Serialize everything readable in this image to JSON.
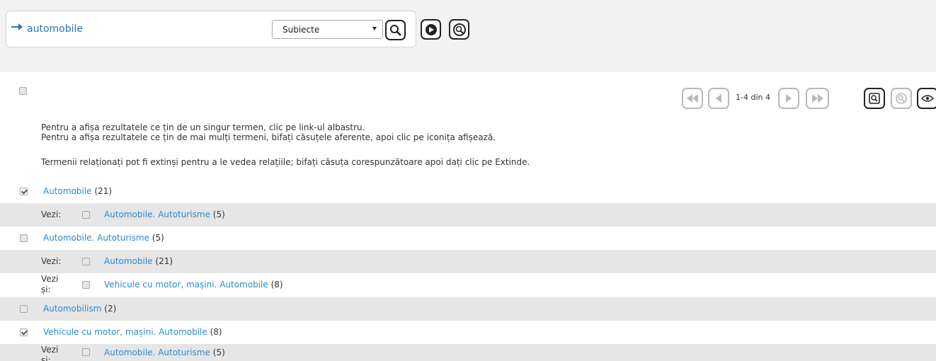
{
  "search": {
    "query": "automobile",
    "scope_selected": "Subiecte"
  },
  "pager": {
    "info": "1-4 din 4"
  },
  "instructions": {
    "line1": "Pentru a afișa rezultatele ce țin de un singur termen, clic pe link-ul albastru.",
    "line2": "Pentru a afișa rezultatele ce țin de mai mulți termeni, bifați căsuțele aferente, apoi clic pe iconița afișează.",
    "line3": "Termenii relaționați pot fi extinși pentru a le vedea relațiile; bifați căsuța corespunzătoare apoi dați clic pe Extinde."
  },
  "rows": [
    {
      "kind": "term",
      "label": "Automobile",
      "count": "(21)",
      "checked": true
    },
    {
      "kind": "related",
      "rel": "Vezi:",
      "label": "Automobile. Autoturisme",
      "count": "(5)"
    },
    {
      "kind": "term",
      "label": "Automobile. Autoturisme",
      "count": "(5)",
      "checked": false
    },
    {
      "kind": "related",
      "rel": "Vezi:",
      "label": "Automobile",
      "count": "(21)"
    },
    {
      "kind": "related",
      "rel_line1": "Vezi",
      "rel_line2": "și:",
      "label": "Vehicule cu motor, mașini. Automobile",
      "count": "(8)"
    },
    {
      "kind": "term",
      "label": "Automobilism",
      "count": "(2)",
      "checked": false
    },
    {
      "kind": "term",
      "label": "Vehicule cu motor, mașini. Automobile",
      "count": "(8)",
      "checked": true
    },
    {
      "kind": "related",
      "rel_line1": "Vezi",
      "rel_line2": "și:",
      "label": "Automobile. Autoturisme",
      "count": "(5)"
    }
  ],
  "icons": {
    "search": "search-icon",
    "browse": "browse-icon",
    "search-history": "search-history-icon",
    "first": "first-page-icon",
    "prev": "prev-page-icon",
    "next": "next-page-icon",
    "last": "last-page-icon",
    "display": "display-icon",
    "expand": "expand-icon",
    "preview": "eye-icon"
  },
  "colors": {
    "link": "#2b8bd0",
    "query": "#2a74bd",
    "band": "#f2f2f2",
    "row_alt": "#e6e6e6"
  }
}
